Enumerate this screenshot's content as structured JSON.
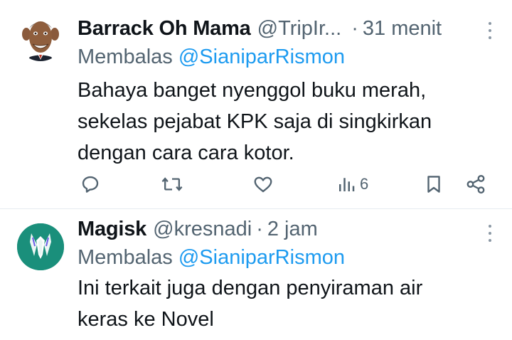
{
  "tweets": [
    {
      "author_name": "Barrack Oh Mama",
      "handle": "@TripIr...",
      "separator": "·",
      "time": "31 menit",
      "reply_prefix": "Membalas",
      "reply_to": "@SianiparRismon",
      "text_lines": [
        "Bahaya banget nyenggol buku merah,",
        "sekelas pejabat KPK saja di singkirkan",
        "dengan cara cara kotor."
      ],
      "actions": {
        "views_count": "6"
      }
    },
    {
      "author_name": "Magisk",
      "handle": "@kresnadi",
      "separator": "·",
      "time": "2 jam",
      "reply_prefix": "Membalas",
      "reply_to": "@SianiparRismon",
      "text_lines": [
        "Ini terkait juga dengan penyiraman air",
        "keras ke Novel"
      ]
    }
  ],
  "icons": {
    "reply": "speech-bubble-icon",
    "repost": "repost-arrows-icon",
    "like": "heart-icon",
    "views": "bar-chart-icon",
    "bookmark": "bookmark-icon",
    "share": "share-icon",
    "more": "vertical-ellipsis-icon"
  },
  "colors": {
    "text": "#0f1419",
    "secondary": "#536471",
    "link": "#1d9bf0",
    "magisk_bg": "#1a8f7b"
  }
}
